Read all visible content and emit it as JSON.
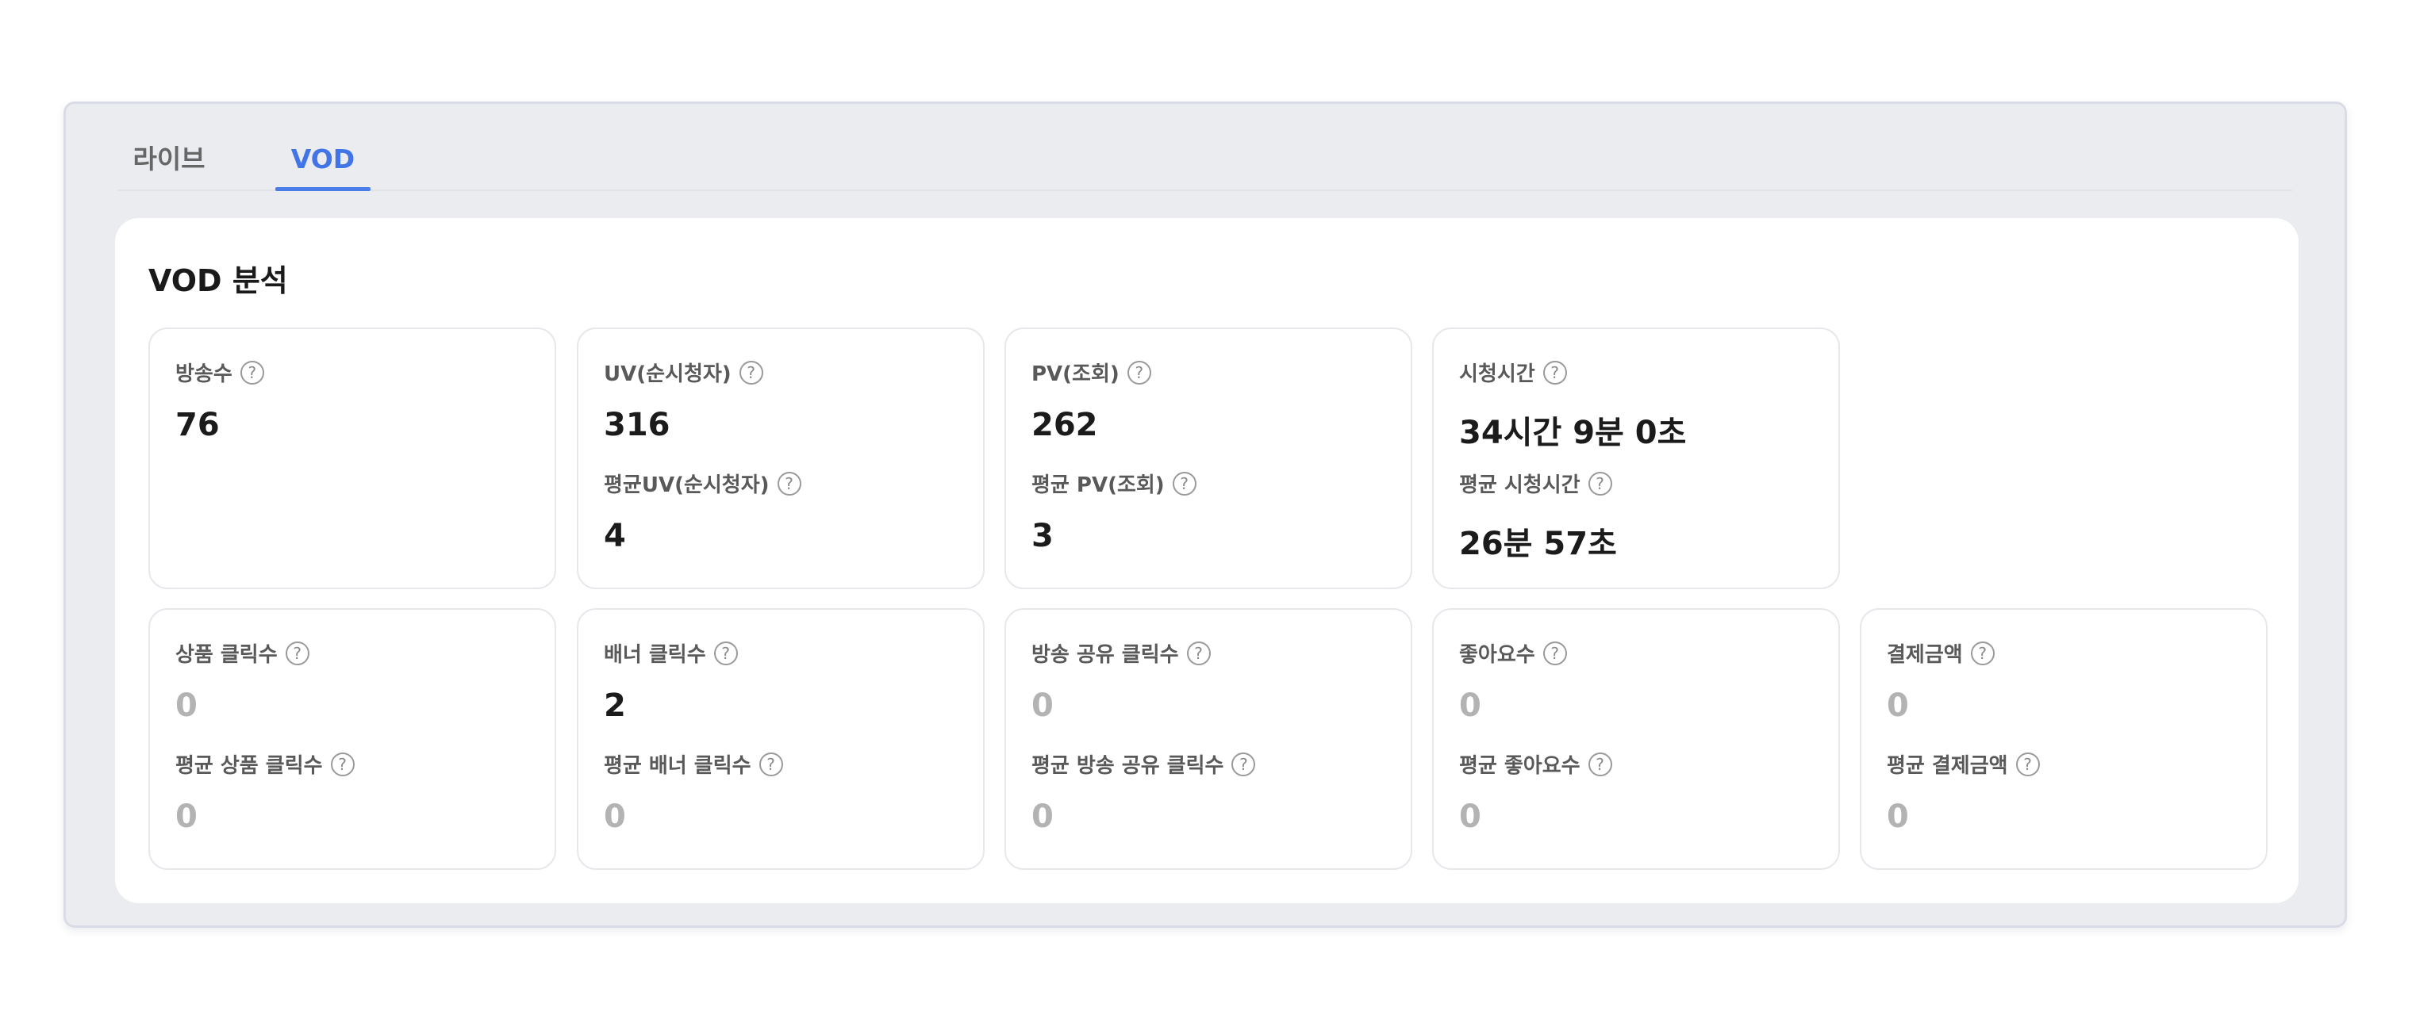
{
  "tabs": [
    {
      "label": "라이브",
      "active": false
    },
    {
      "label": "VOD",
      "active": true
    }
  ],
  "title": "VOD 분석",
  "help_glyph": "?",
  "colors": {
    "accent": "#4174e6",
    "muted_value": "#b3b3b3"
  },
  "row1": [
    {
      "label": "방송수",
      "value": "76"
    },
    {
      "label": "UV(순시청자)",
      "value": "316",
      "sub_label": "평균UV(순시청자)",
      "sub_value": "4"
    },
    {
      "label": "PV(조회)",
      "value": "262",
      "sub_label": "평균 PV(조회)",
      "sub_value": "3"
    },
    {
      "label": "시청시간",
      "value": "34시간 9분 0초",
      "sub_label": "평균 시청시간",
      "sub_value": "26분 57초"
    }
  ],
  "row2": [
    {
      "label": "상품 클릭수",
      "value": "0",
      "sub_label": "평균 상품 클릭수",
      "sub_value": "0"
    },
    {
      "label": "배너 클릭수",
      "value": "2",
      "sub_label": "평균 배너 클릭수",
      "sub_value": "0"
    },
    {
      "label": "방송 공유 클릭수",
      "value": "0",
      "sub_label": "평균 방송 공유 클릭수",
      "sub_value": "0"
    },
    {
      "label": "좋아요수",
      "value": "0",
      "sub_label": "평균 좋아요수",
      "sub_value": "0"
    },
    {
      "label": "결제금액",
      "value": "0",
      "sub_label": "평균 결제금액",
      "sub_value": "0"
    }
  ]
}
